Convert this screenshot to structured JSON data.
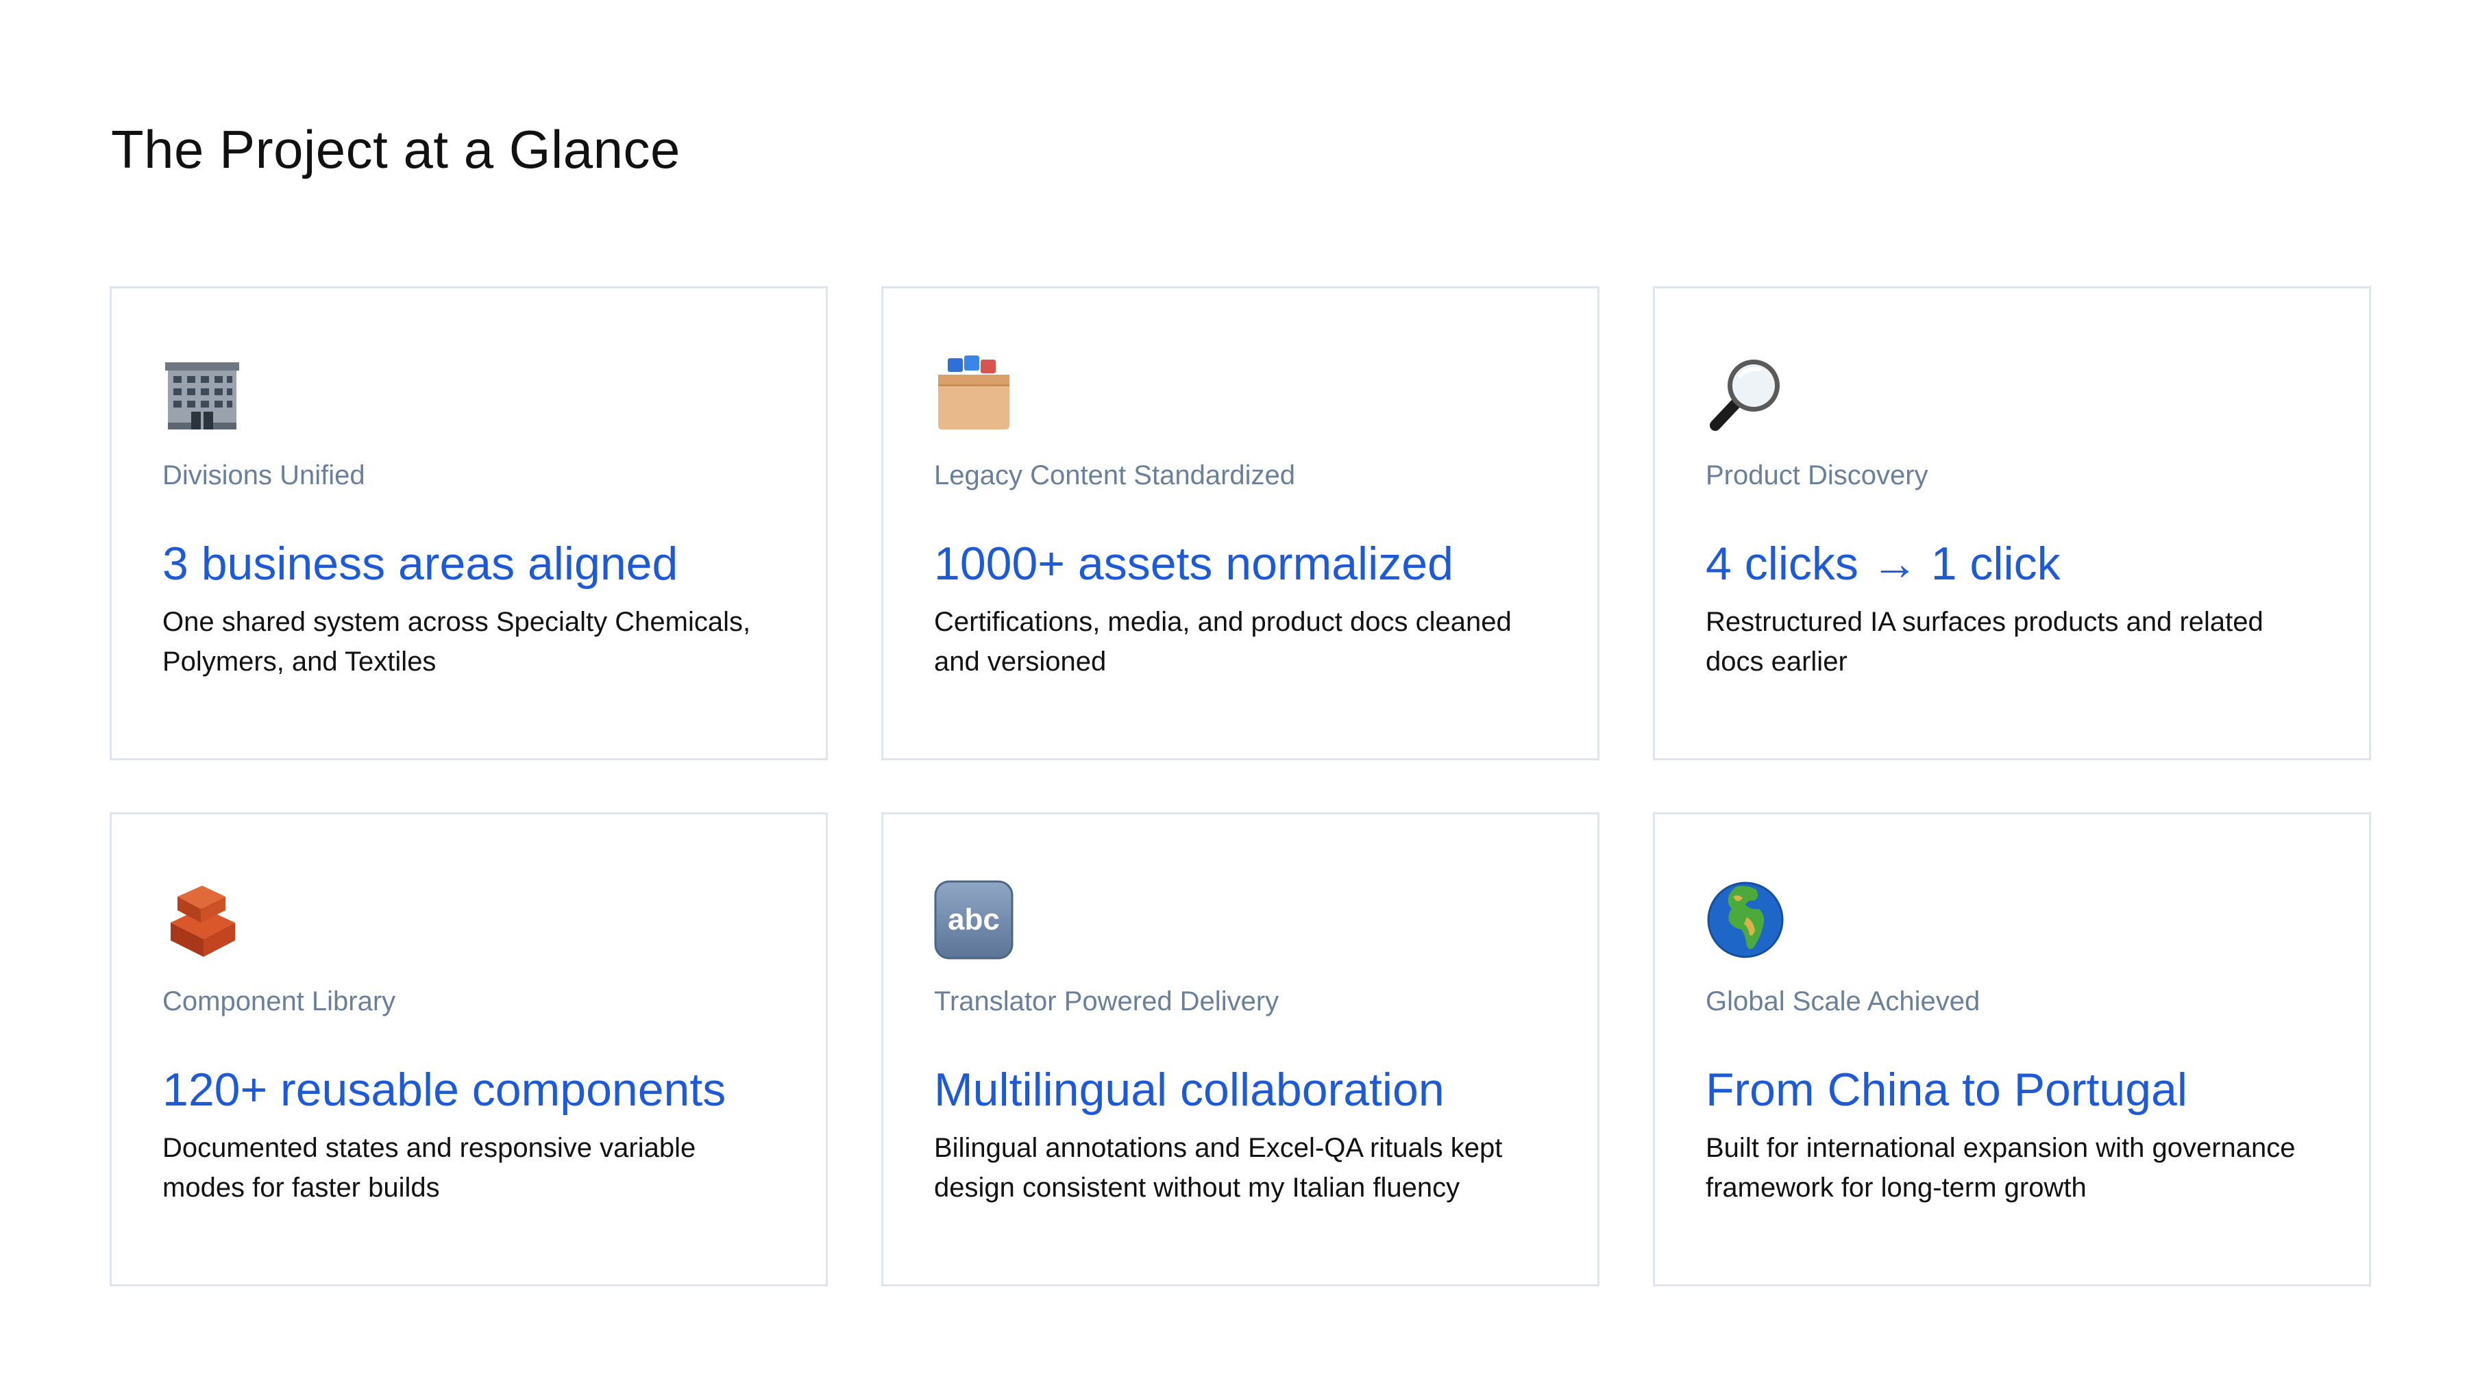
{
  "page": {
    "title": "The Project at a Glance"
  },
  "cards": [
    {
      "icon": "office-building-icon",
      "label": "Divisions Unified",
      "metric": "3 business areas aligned",
      "description": "One shared system across Specialty Chemicals, Polymers, and Textiles"
    },
    {
      "icon": "card-file-box-icon",
      "label": "Legacy Content Standardized",
      "metric": "1000+ assets normalized",
      "description": "Certifications, media, and product docs cleaned and versioned"
    },
    {
      "icon": "magnifying-glass-icon",
      "label": "Product Discovery",
      "metric": "4 clicks → 1 click",
      "description": "Restructured IA surfaces products and related docs earlier"
    },
    {
      "icon": "brick-icon",
      "label": "Component Library",
      "metric": "120+ reusable components",
      "description": "Documented states and responsive variable modes for faster builds"
    },
    {
      "icon": "abc-letters-icon",
      "label": "Translator Powered Delivery",
      "metric": "Multilingual collaboration",
      "description": "Bilingual annotations and Excel-QA rituals kept design consistent without my Italian fluency"
    },
    {
      "icon": "globe-europe-africa-icon",
      "label": "Global Scale Achieved",
      "metric": "From China to Portugal",
      "description": "Built for international expansion with governance framework for long-term growth"
    }
  ],
  "colors": {
    "accent": "#1f5ad6",
    "label": "#6b7f99",
    "border": "#dfe5ee",
    "text": "#111111"
  }
}
